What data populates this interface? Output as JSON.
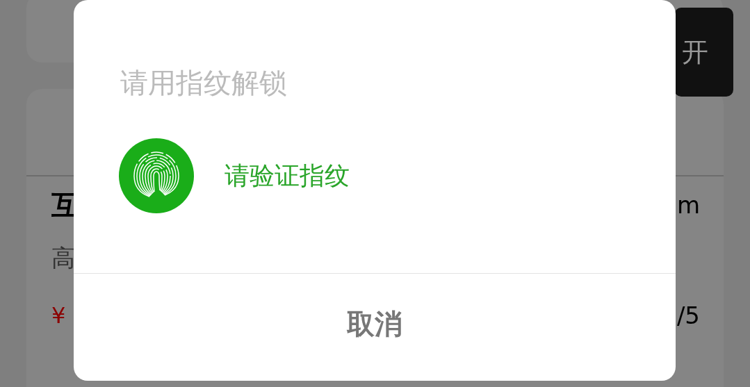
{
  "background": {
    "top_button": {
      "label": "开"
    },
    "card": {
      "title": "互",
      "distance": "m",
      "subtitle": "高",
      "price_symbol": "¥",
      "rating": "/5"
    }
  },
  "dialog": {
    "title": "请用指纹解锁",
    "prompt": "请验证指纹",
    "cancel": "取消"
  }
}
